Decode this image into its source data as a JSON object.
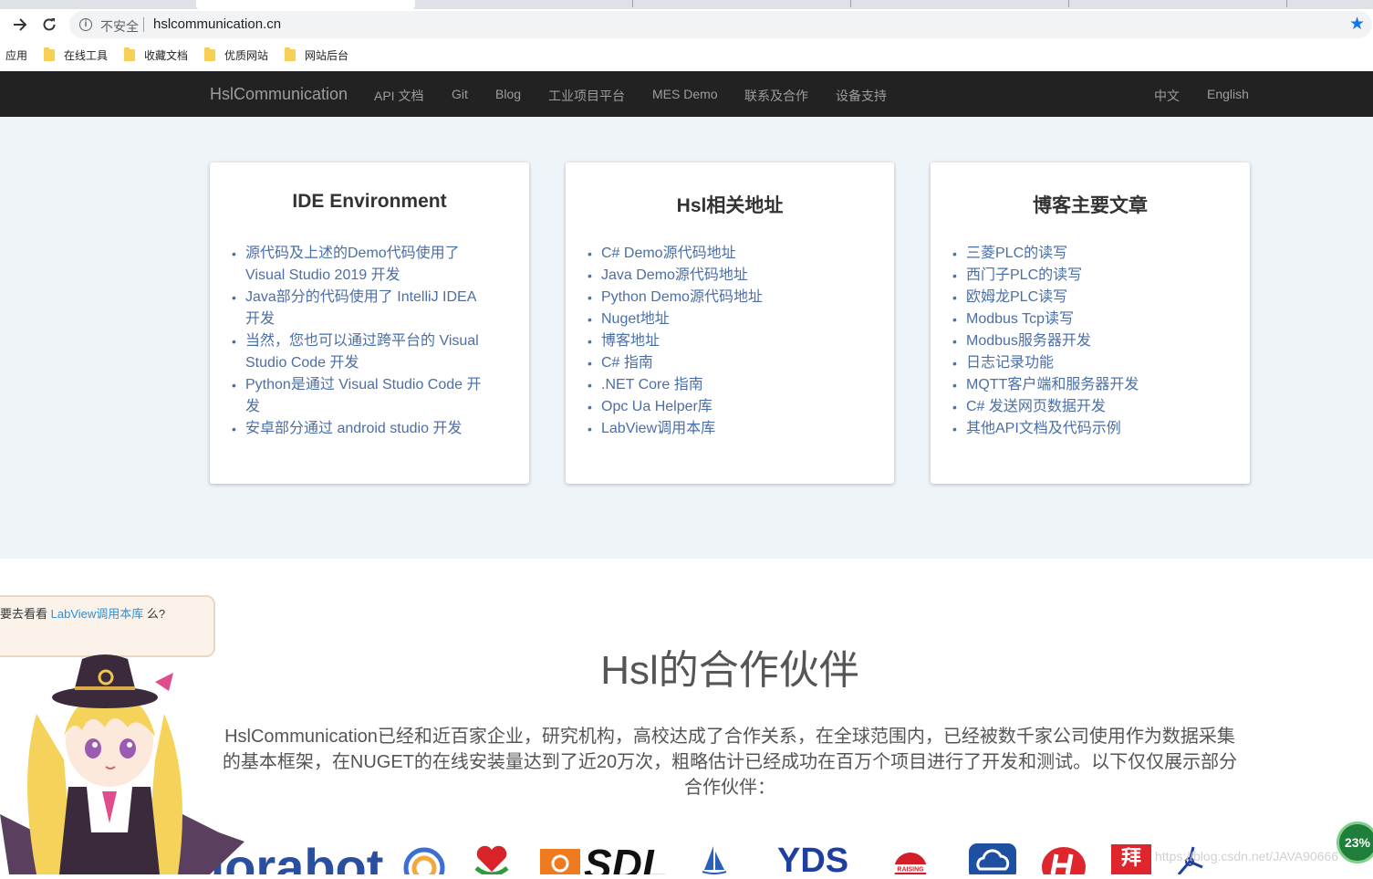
{
  "browser": {
    "insecure_label": "不安全",
    "url": "hslcommunication.cn",
    "bookmarks": [
      "应用",
      "在线工具",
      "收藏文档",
      "优质网站",
      "网站后台"
    ]
  },
  "navbar": {
    "brand": "HslCommunication",
    "links": [
      "API 文档",
      "Git",
      "Blog",
      "工业项目平台",
      "MES Demo",
      "联系及合作",
      "设备支持"
    ],
    "lang": [
      "中文",
      "English"
    ]
  },
  "cards": [
    {
      "title": "IDE Environment",
      "items": [
        "源代码及上述的Demo代码使用了",
        "Visual Studio 2019 开发",
        "Java部分的代码使用了 IntelliJ IDEA",
        "开发",
        "当然，您也可以通过跨平台的 Visual",
        "Studio Code 开发",
        "Python是通过 Visual Studio Code 开",
        "发",
        "安卓部分通过 android studio 开发"
      ]
    },
    {
      "title": "Hsl相关地址",
      "items": [
        "C# Demo源代码地址",
        "Java Demo源代码地址",
        "Python Demo源代码地址",
        "Nuget地址",
        "博客地址",
        "C# 指南",
        ".NET Core 指南",
        "Opc Ua Helper库",
        "LabView调用本库"
      ]
    },
    {
      "title": "博客主要文章",
      "items": [
        "三菱PLC的读写",
        "西门子PLC的读写",
        "欧姆龙PLC读写",
        "Modbus Tcp读写",
        "Modbus服务器开发",
        "日志记录功能",
        "MQTT客户端和服务器开发",
        "C# 发送网页数据开发",
        "其他API文档及代码示例"
      ]
    }
  ],
  "partners": {
    "title": "Hsl的合作伙伴",
    "desc_lines": [
      "HslCommunication已经和近百家企业，研究机构，高校达成了合作关系，在全球范围内，已经被数千家公司使用作为数据采集",
      "的基本框架，在NUGET的在线安装量达到了近20万次，粗略估计已经成功在百万个项目进行了开发和测试。以下仅仅展示部分",
      "合作伙伴："
    ],
    "logo_texts": [
      "dorabot",
      "SDL",
      "YDS",
      "RAISING",
      "拜"
    ]
  },
  "widget": {
    "prefix": "要去看看 ",
    "link": "LabView调用本库",
    "suffix": " 么?",
    "percent": "23%",
    "watermark": "https://blog.csdn.net/JAVA90666"
  },
  "colors": {
    "navbar": "#222222",
    "link": "#4a6ea8",
    "section_bg": "#eff4f9"
  }
}
